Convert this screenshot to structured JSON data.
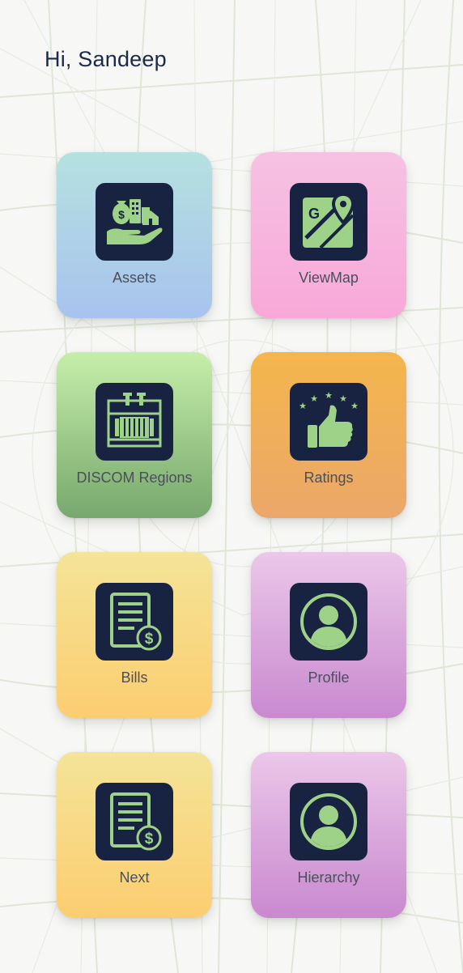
{
  "header": {
    "greeting": "Hi, Sandeep"
  },
  "colors": {
    "icon_bg": "#182342",
    "icon_fg": "#9fd289",
    "text": "#4a4f5a"
  },
  "tiles": [
    {
      "label": "Assets",
      "icon": "assets-icon"
    },
    {
      "label": "ViewMap",
      "icon": "map-icon"
    },
    {
      "label": "DISCOM Regions",
      "icon": "transformer-icon"
    },
    {
      "label": "Ratings",
      "icon": "thumbs-up-icon"
    },
    {
      "label": "Bills",
      "icon": "bill-icon"
    },
    {
      "label": "Profile",
      "icon": "user-icon"
    },
    {
      "label": "Next",
      "icon": "bill-icon"
    },
    {
      "label": "Hierarchy",
      "icon": "user-icon"
    }
  ]
}
